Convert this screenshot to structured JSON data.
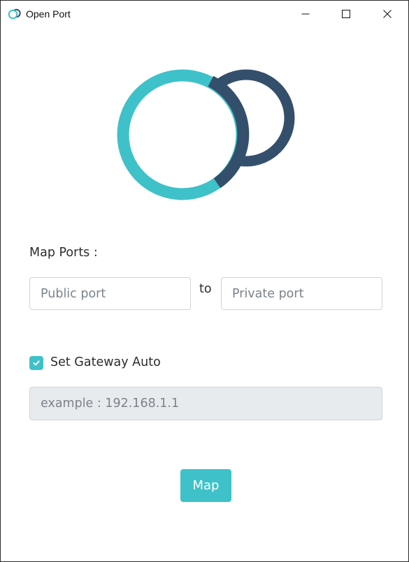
{
  "window": {
    "title": "Open Port",
    "controls": {
      "minimize": "minimize-icon",
      "maximize": "maximize-icon",
      "close": "close-icon"
    }
  },
  "logo": {
    "icon": "open-port-logo",
    "colors": {
      "teal": "#3ec1c9",
      "navy": "#344f6b"
    }
  },
  "form": {
    "map_ports_label": "Map Ports :",
    "public_port": {
      "value": "",
      "placeholder": "Public port"
    },
    "to_label": "to",
    "private_port": {
      "value": "",
      "placeholder": "Private port"
    },
    "gateway_auto": {
      "label": "Set Gateway Auto",
      "checked": true
    },
    "gateway_input": {
      "value": "",
      "placeholder": "example : 192.168.1.1",
      "disabled": true
    },
    "map_button": "Map"
  },
  "colors": {
    "accent": "#3ec1c9",
    "secondary": "#344f6b",
    "disabled_bg": "#e8ebee"
  }
}
